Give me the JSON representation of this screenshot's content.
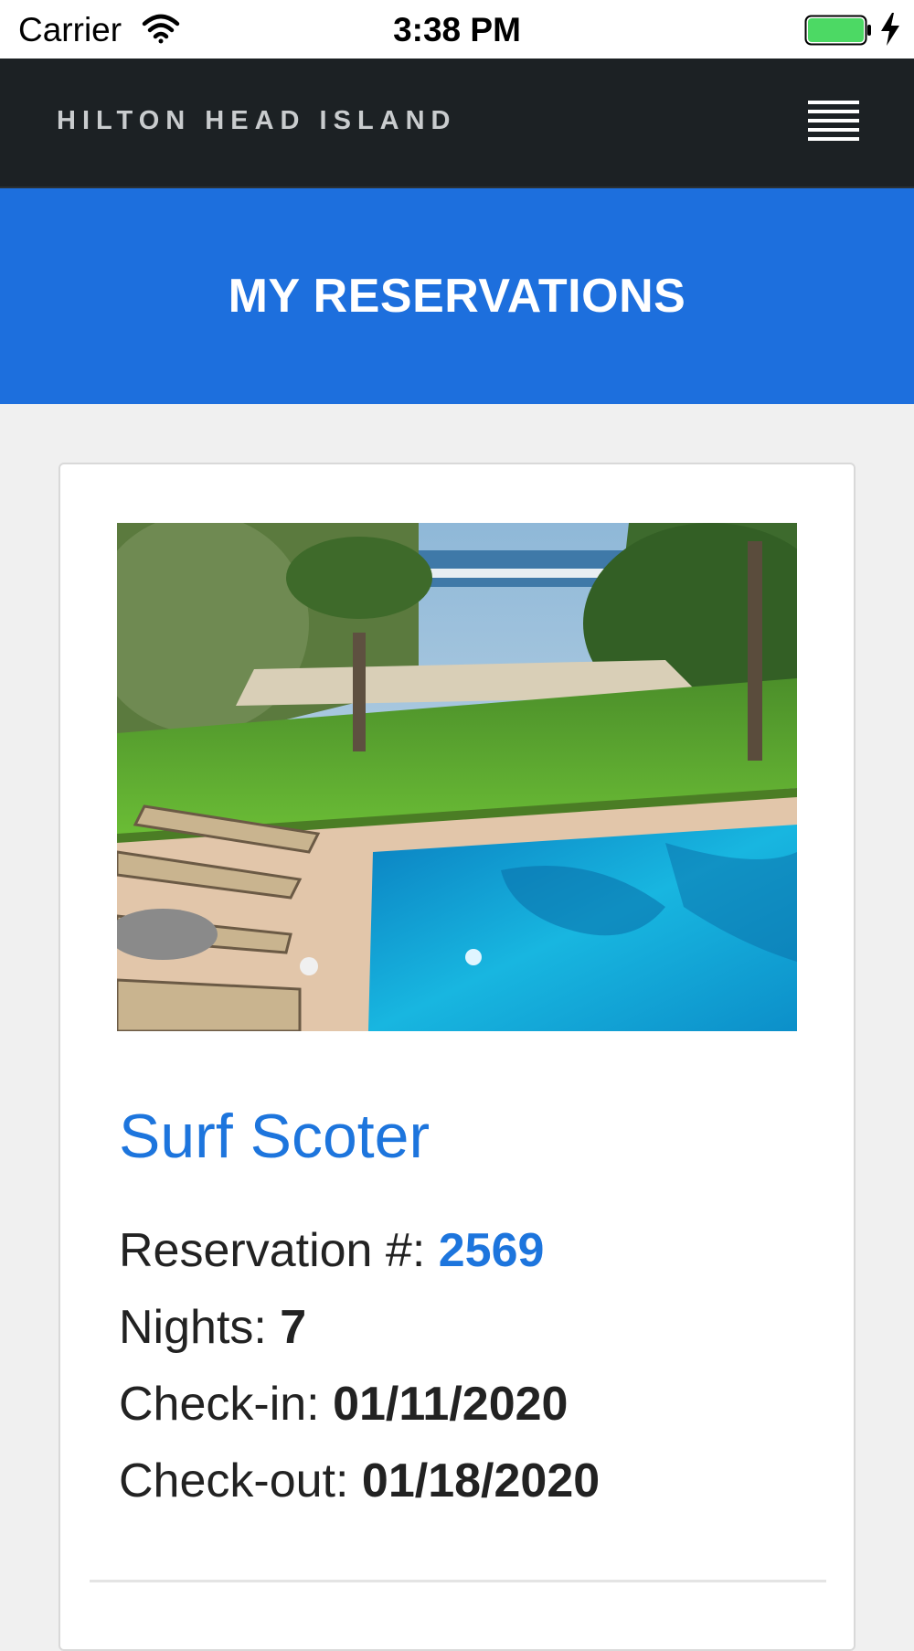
{
  "status_bar": {
    "carrier": "Carrier",
    "time": "3:38 PM",
    "battery_color": "#4cd964"
  },
  "navbar": {
    "brand": "HILTON HEAD ISLAND",
    "menu_icon": "hamburger-menu-icon"
  },
  "hero": {
    "title": "MY RESERVATIONS",
    "background_color": "#1d6fdd"
  },
  "reservation": {
    "photo_icon": "property-photo",
    "property_name": "Surf Scoter",
    "reservation_label": "Reservation #:",
    "reservation_number": "2569",
    "nights_label": "Nights:",
    "nights": "7",
    "checkin_label": "Check-in:",
    "checkin": "01/11/2020",
    "checkout_label": "Check-out:",
    "checkout": "01/18/2020"
  },
  "colors": {
    "accent": "#1d75dd",
    "navbar": "#1c2124",
    "page_background": "#f0f0f0"
  }
}
